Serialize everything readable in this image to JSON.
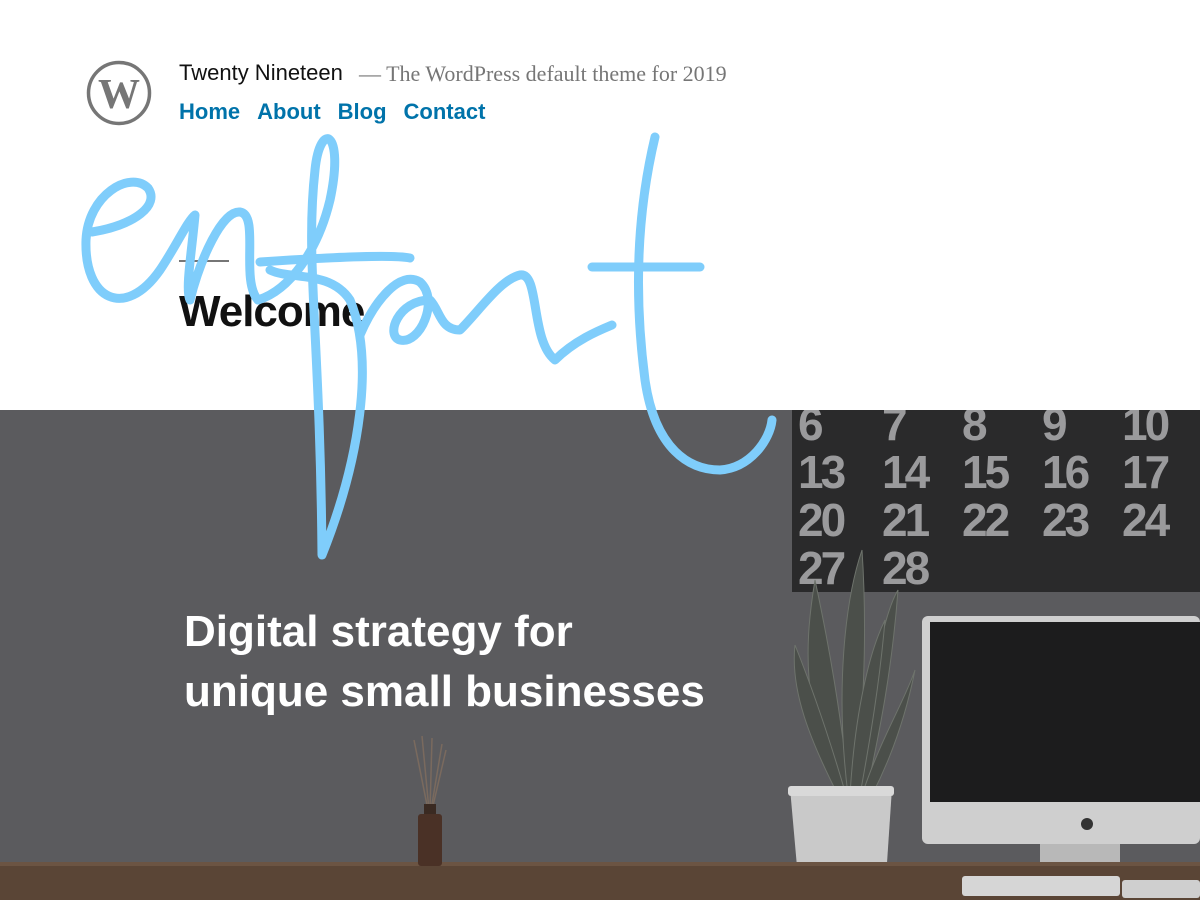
{
  "header": {
    "site_title": "Twenty Nineteen",
    "site_description": "— The WordPress default theme for 2019",
    "logo_icon": "wordpress-logo-icon",
    "nav": [
      {
        "label": "Home"
      },
      {
        "label": "About"
      },
      {
        "label": "Blog"
      },
      {
        "label": "Contact"
      }
    ]
  },
  "main": {
    "page_title": "Welcome"
  },
  "hero": {
    "line1": "Digital strategy for",
    "line2": "unique small businesses",
    "calendar_numbers": [
      [
        "6",
        "7",
        "8",
        "9",
        "10"
      ],
      [
        "13",
        "14",
        "15",
        "16",
        "17"
      ],
      [
        "20",
        "21",
        "22",
        "23",
        "24"
      ],
      [
        "27",
        "28"
      ]
    ]
  },
  "overlay": {
    "handwriting": "enfant",
    "color": "#7fcdfb"
  },
  "colors": {
    "link": "#0073aa",
    "hero_overlay": "#5b5b5e",
    "muted": "#767676"
  }
}
